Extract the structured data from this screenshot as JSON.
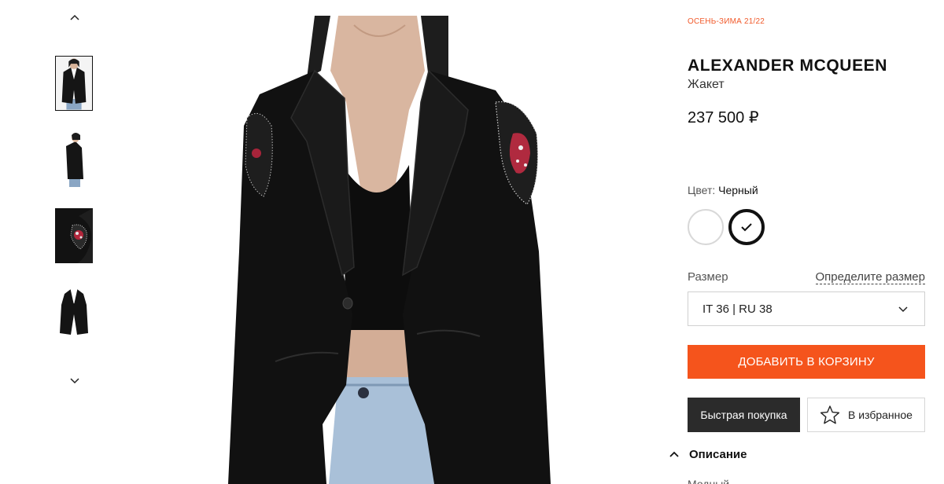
{
  "thumbnails": {
    "up_icon": "chevron-up-icon",
    "down_icon": "chevron-down-icon",
    "items": [
      "front-view",
      "side-view",
      "shoulder-detail",
      "flat-lay"
    ],
    "active_index": 0
  },
  "product": {
    "season": "ОСЕНЬ-ЗИМА 21/22",
    "brand": "ALEXANDER MCQUEEN",
    "type": "Жакет",
    "price": "237 500 ₽"
  },
  "color": {
    "label": "Цвет:",
    "value": "Черный",
    "swatches": [
      {
        "name": "white",
        "hex": "#ffffff",
        "selected": false
      },
      {
        "name": "black",
        "hex": "#111111",
        "selected": true
      }
    ]
  },
  "size": {
    "label": "Размер",
    "guide_link": "Определите размер",
    "selected": "IT 36 | RU 38"
  },
  "actions": {
    "add_to_cart": "ДОБАВИТЬ В КОРЗИНУ",
    "quick_buy": "Быстрая покупка",
    "wishlist": "В избранное"
  },
  "description": {
    "title": "Описание",
    "peek": "Модный"
  },
  "colors": {
    "accent": "#f5541c",
    "season": "#f15a2b",
    "dark_button": "#2b2b2b"
  }
}
